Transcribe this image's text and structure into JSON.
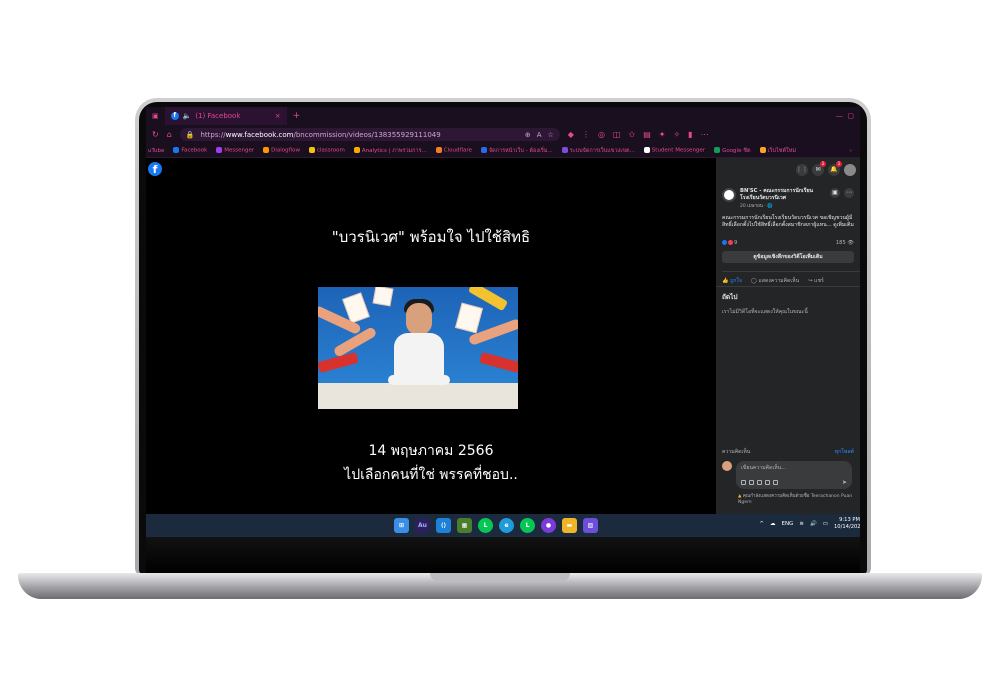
{
  "browser": {
    "tab_title": "(1) Facebook",
    "tab_close": "×",
    "new_tab": "+",
    "url_prefix": "https://",
    "url_domain": "www.facebook.com",
    "url_path": "/bncommission/videos/138355929111049",
    "bookmarks": [
      {
        "label": "uTube",
        "color": "#e64a8c"
      },
      {
        "label": "Facebook",
        "color": "#1877f2"
      },
      {
        "label": "Messenger",
        "color": "#a33bf0"
      },
      {
        "label": "Dialogflow",
        "color": "#ff9800"
      },
      {
        "label": "classroom",
        "color": "#f4c20d"
      },
      {
        "label": "Analytics | ภาพรวมการ...",
        "color": "#f9ab00"
      },
      {
        "label": "Cloudflare",
        "color": "#f38020"
      },
      {
        "label": "จัดการหน้าเว็บ - ต้องเริ่ม...",
        "color": "#2a6ae9"
      },
      {
        "label": "ระบบจัดการเว็บแขวงเขต...",
        "color": "#7b4dd8"
      },
      {
        "label": "Student Messenger",
        "color": "#ffffff"
      },
      {
        "label": "Google ชีต",
        "color": "#0f9d58"
      },
      {
        "label": "เว็บไซต์ใหม่",
        "color": "#f5a623"
      }
    ]
  },
  "video": {
    "title": "\"บวรนิเวศ\" พร้อมใจ ไปใช้สิทธิ",
    "date": "14 พฤษภาคม 2566",
    "subtitle": "ไปเลือกคนที่ใช่ พรรคที่ชอบ..",
    "fb_letter": "f"
  },
  "panel": {
    "badges": [
      "1",
      "1"
    ],
    "page_name": "BN'SC - คณะกรรมการนักเรียนโรงเรียนวัดบวรนิเวศ",
    "post_time": "20 เมษายน · 🌐",
    "post_text": "คณะกรรมการนักเรียนโรงเรียนวัดบวรนิเวศ ขอเชิญชวนผู้มีสิทธิ์เลือกตั้งไปใช้สิทธิ์เลือกตั้งสมาชิกสภาผู้แทน... ดูเพิ่มเติม",
    "reaction_count": "9",
    "view_count": "185 👁",
    "see_more_button": "ดูข้อมูลเชิงลึกของวิดีโอเพิ่มเติม",
    "actions": [
      "ถูกใจ",
      "แสดงความคิดเห็น",
      "แชร์"
    ],
    "next_heading": "ถัดไป",
    "next_empty": "เราไม่มีวิดีโอที่จะแสดงให้คุณในขณะนี้",
    "comments_label": "ความคิดเห็น",
    "comments_sort": "ทุกโพสต์",
    "comment_placeholder": "เขียนความคิดเห็น...",
    "comment_warning": "คุณกำลังแสดงความคิดเห็นด้วยชื่อ Teerachanon Puan Ngern"
  },
  "taskbar": {
    "apps": [
      {
        "label": "",
        "color": "#3a8ee6",
        "name": "windows-start-icon"
      },
      {
        "label": "Au",
        "color": "#2b1f5c",
        "name": "audition-icon"
      },
      {
        "label": "",
        "color": "#1e80d6",
        "name": "vscode-icon"
      },
      {
        "label": "",
        "color": "#4a7d2c",
        "name": "minecraft-icon"
      },
      {
        "label": "",
        "color": "#06c755",
        "name": "line-icon"
      },
      {
        "label": "",
        "color": "#1e9bd8",
        "name": "edge-icon"
      },
      {
        "label": "",
        "color": "#06c755",
        "name": "line-2-icon"
      },
      {
        "label": "",
        "color": "#7c3ad8",
        "name": "github-icon"
      },
      {
        "label": "",
        "color": "#f0b429",
        "name": "file-explorer-icon"
      },
      {
        "label": "",
        "color": "#6b4fd8",
        "name": "photos-icon"
      }
    ],
    "lang": "ENG",
    "time": "9:13 PM",
    "date": "10/14/2023"
  }
}
